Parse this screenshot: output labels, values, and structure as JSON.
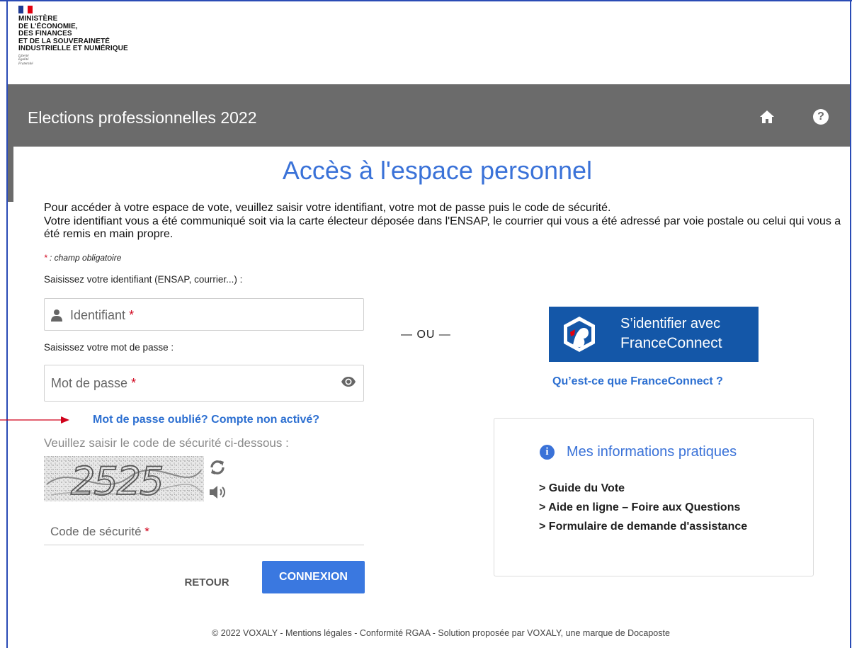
{
  "ministry": {
    "lines": [
      "MINISTÈRE",
      "DE L'ÉCONOMIE,",
      "DES FINANCES",
      "ET DE LA SOUVERAINETÉ",
      "INDUSTRIELLE ET NUMÉRIQUE"
    ],
    "motto": [
      "Liberté",
      "Égalité",
      "Fraternité"
    ],
    "flag_colors": [
      "#1f3a93",
      "#ffffff",
      "#e1000f"
    ]
  },
  "header": {
    "title": "Elections professionnelles 2022",
    "home_icon": "home-icon",
    "help_label": "?"
  },
  "page_title": "Accès à l'espace personnel",
  "intro": {
    "line1": "Pour accéder à votre espace de vote, veuillez saisir votre identifiant, votre mot de passe puis le code de sécurité.",
    "line2": "Votre identifiant vous a été communiqué soit via la carte électeur déposée dans l'ENSAP, le courrier qui vous a été adressé par voie postale ou celui qui vous a été remis en main propre."
  },
  "required_note": {
    "star": "*",
    "text": " : champ obligatoire"
  },
  "form": {
    "identifier_label": "Saisissez votre identifiant (ENSAP, courrier...) :",
    "identifier_placeholder": "Identifiant",
    "password_label": "Saisissez votre mot de passe :",
    "password_placeholder": "Mot de passe",
    "required_star": "*",
    "forgot_link": "Mot de passe oublié? Compte non activé?",
    "captcha_label": "Veuillez saisir le code de sécurité ci-dessous :",
    "captcha_text": "2525",
    "code_placeholder": "Code de sécurité",
    "back_button": "RETOUR",
    "submit_button": "CONNEXION"
  },
  "separator": "— OU —",
  "franceconnect": {
    "line1": "S’identifier avec",
    "line2": "FranceConnect",
    "help_link": "Qu’est-ce que FranceConnect ?",
    "color": "#1457a8"
  },
  "info_box": {
    "title": "Mes informations pratiques",
    "links": [
      "> Guide du Vote",
      "> Aide en ligne – Foire aux Questions",
      "> Formulaire de demande d'assistance"
    ]
  },
  "footer": "© 2022 VOXALY - Mentions légales - Conformité RGAA - Solution proposée par VOXALY, une marque de Docaposte",
  "colors": {
    "accent": "#3a72d8",
    "header_bg": "#6b6b6b",
    "required": "#d0021b",
    "annotation": "#d0021b"
  }
}
